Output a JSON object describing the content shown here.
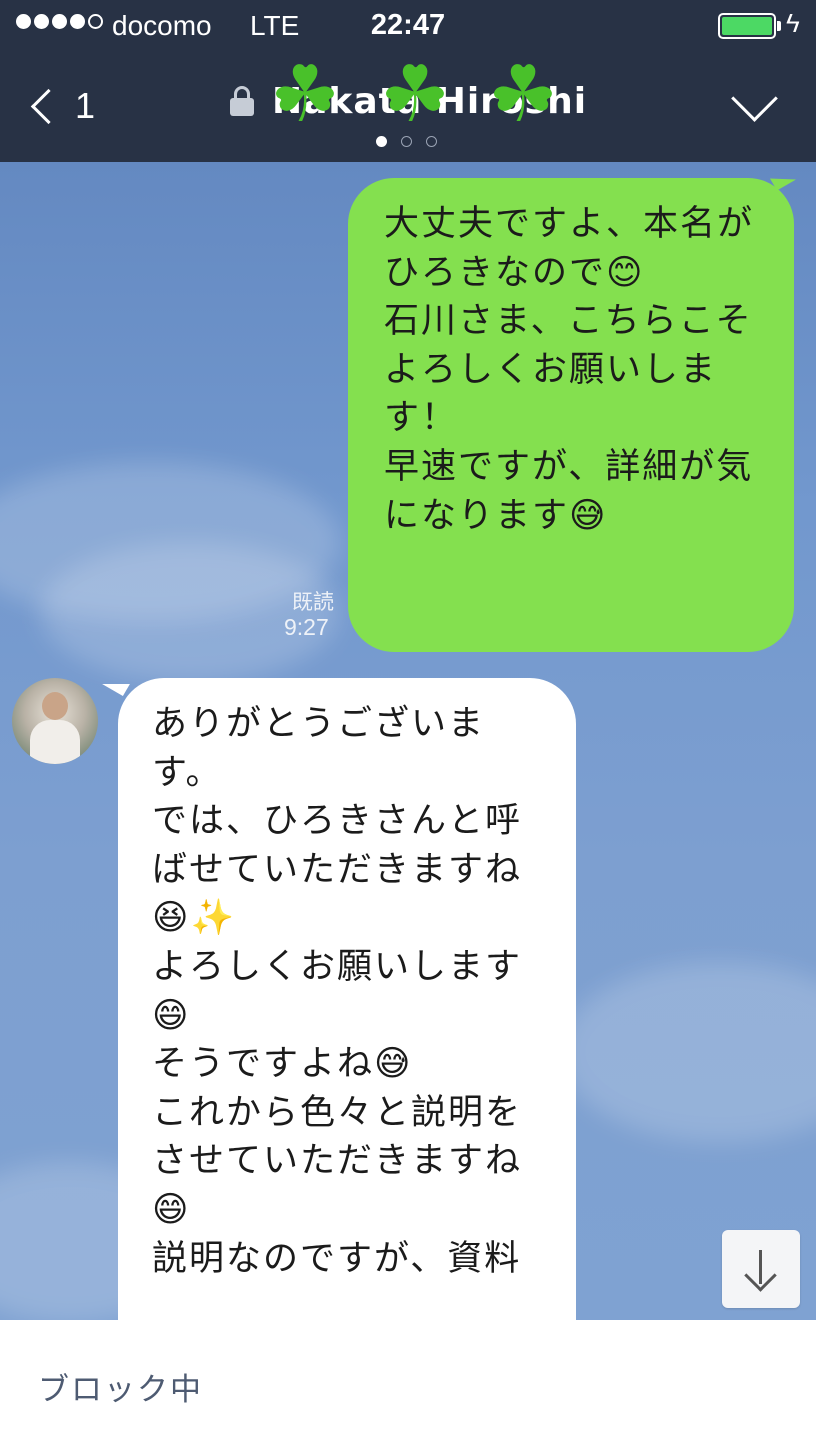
{
  "status_bar": {
    "carrier": "docomo",
    "network": "LTE",
    "time": "22:47",
    "signal_bars_filled": 4,
    "signal_bars_total": 5,
    "battery_level": 0.9,
    "charging_icon": "bolt-icon"
  },
  "nav": {
    "back_icon": "chevron-left-icon",
    "back_count": "1",
    "title": "Nakata Hiroshi",
    "lock_icon": "lock-icon",
    "title_decoration": [
      "☘",
      "☘",
      "☘"
    ],
    "page_dots_total": 3,
    "page_dots_active": 1,
    "menu_icon": "chevron-down-icon",
    "header_color": "#283245"
  },
  "messages": {
    "outgoing": {
      "lines": [
        "大丈夫ですよ、本名が",
        "ひろきなので😊",
        "",
        "石川さま、こちらこそ",
        "よろしくお願いしま",
        "す！",
        "",
        "早速ですが、詳細が気",
        "になります😅"
      ],
      "read_label": "既読",
      "time": "9:27",
      "bubble_color": "#84e04f"
    },
    "incoming": {
      "lines": [
        "ありがとうございま",
        "す。",
        "では、ひろきさんと呼",
        "ばせていただきますね",
        "😆✨",
        "よろしくお願いします",
        "😄",
        "",
        "そうですよね😅",
        "これから色々と説明を",
        "させていただきますね",
        "😄",
        "説明なのですが、資料"
      ],
      "bubble_color": "#ffffff"
    }
  },
  "scroll_button": {
    "icon": "arrow-down-icon"
  },
  "footer": {
    "blocked_label": "ブロック中"
  }
}
